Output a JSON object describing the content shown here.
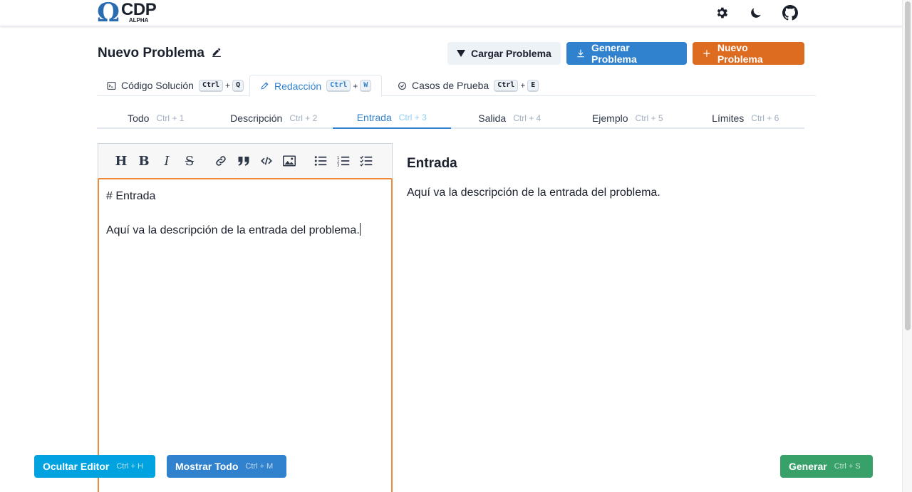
{
  "brand": {
    "symbol": "Ω",
    "name": "CDP",
    "tag": "ALPHA"
  },
  "navbar": {
    "icons": [
      "gear-icon",
      "moon-icon",
      "github-icon"
    ]
  },
  "problem": {
    "title": "Nuevo Problema"
  },
  "actions": {
    "load": "Cargar Problema",
    "generate": "Generar Problema",
    "new": "Nuevo Problema"
  },
  "main_tabs": [
    {
      "label": "Código Solución",
      "keys": [
        "Ctrl",
        "Q"
      ],
      "active": false
    },
    {
      "label": "Redacción",
      "keys": [
        "Ctrl",
        "W"
      ],
      "active": true
    },
    {
      "label": "Casos de Prueba",
      "keys": [
        "Ctrl",
        "E"
      ],
      "active": false
    }
  ],
  "plus": "+",
  "sub_tabs": [
    {
      "label": "Todo",
      "hint": "Ctrl + 1"
    },
    {
      "label": "Descripción",
      "hint": "Ctrl + 2"
    },
    {
      "label": "Entrada",
      "hint": "Ctrl + 3",
      "active": true
    },
    {
      "label": "Salida",
      "hint": "Ctrl + 4"
    },
    {
      "label": "Ejemplo",
      "hint": "Ctrl + 5"
    },
    {
      "label": "Límites",
      "hint": "Ctrl + 6"
    }
  ],
  "editor": {
    "toolbar": [
      "H",
      "B",
      "I",
      "S",
      "link-icon",
      "quote-icon",
      "code-icon",
      "image-icon",
      "unordered-list-icon",
      "ordered-list-icon",
      "checklist-icon"
    ],
    "line1": "# Entrada",
    "line2": "",
    "line3": "Aquí va la descripción de la entrada del problema."
  },
  "preview": {
    "heading": "Entrada",
    "body": "Aquí va la descripción de la entrada del problema."
  },
  "footer": {
    "hide_editor": "Ocultar Editor",
    "hide_editor_hint": "Ctrl + H",
    "show_all": "Mostrar Todo",
    "show_all_hint": "Ctrl + M",
    "generate": "Generar",
    "generate_hint": "Ctrl + S"
  },
  "colors": {
    "primary": "#3182ce",
    "accent": "#dd6b20",
    "success": "#38a169",
    "info": "#00a3e0"
  }
}
